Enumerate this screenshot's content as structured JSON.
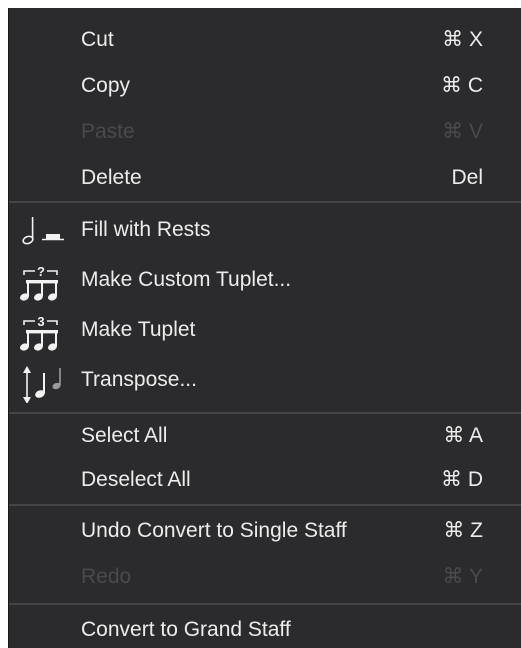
{
  "menu": {
    "items": [
      {
        "label": "Cut",
        "shortcut": "⌘ X",
        "enabled": true
      },
      {
        "label": "Copy",
        "shortcut": "⌘ C",
        "enabled": true
      },
      {
        "label": "Paste",
        "shortcut": "⌘ V",
        "enabled": false
      },
      {
        "label": "Delete",
        "shortcut": "Del",
        "enabled": true
      },
      {
        "label": "Fill with Rests",
        "icon": "fill-rests-icon",
        "enabled": true
      },
      {
        "label": "Make Custom Tuplet...",
        "icon": "custom-tuplet-icon",
        "enabled": true
      },
      {
        "label": "Make Tuplet",
        "icon": "triplet-icon",
        "enabled": true
      },
      {
        "label": "Transpose...",
        "icon": "transpose-icon",
        "enabled": true
      },
      {
        "label": "Select All",
        "shortcut": "⌘ A",
        "enabled": true
      },
      {
        "label": "Deselect All",
        "shortcut": "⌘ D",
        "enabled": true
      },
      {
        "label": "Undo Convert to Single Staff",
        "shortcut": "⌘ Z",
        "enabled": true
      },
      {
        "label": "Redo",
        "shortcut": "⌘ Y",
        "enabled": false
      },
      {
        "label": "Convert to Grand Staff",
        "enabled": true
      }
    ],
    "tuplet_marks": {
      "custom": "?",
      "triplet": "3"
    }
  },
  "colors": {
    "background": "#2b2b2d",
    "text": "#ececec",
    "disabled_text": "#4a4a4c",
    "separator": "#444446"
  }
}
